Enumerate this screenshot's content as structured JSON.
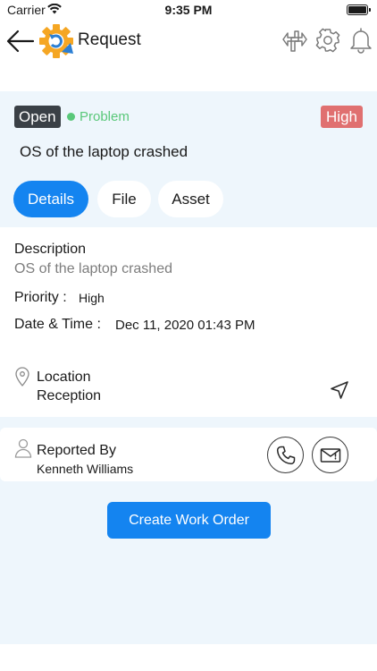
{
  "status_bar": {
    "carrier": "Carrier",
    "time": "9:35 PM",
    "battery_level": 1.0
  },
  "header": {
    "title": "Request"
  },
  "request": {
    "status": "Open",
    "type": "Problem",
    "priority_badge": "High",
    "subject": "OS of the laptop crashed"
  },
  "tabs": [
    {
      "label": "Details",
      "active": true
    },
    {
      "label": "File",
      "active": false
    },
    {
      "label": "Asset",
      "active": false
    }
  ],
  "details": {
    "description_label": "Description",
    "description_value": "OS of the laptop crashed",
    "priority_label": "Priority :",
    "priority_value": "High",
    "datetime_label": "Date & Time :",
    "datetime_value": "Dec 11, 2020 01:43 PM",
    "location_label": "Location",
    "location_value": "Reception"
  },
  "reporter": {
    "label": "Reported By",
    "name": "Kenneth Williams"
  },
  "actions": {
    "create_work_order": "Create Work Order"
  },
  "colors": {
    "accent": "#1484f0",
    "status_dark": "#3a4046",
    "priority_high": "#e07070",
    "problem_green": "#5ac87a",
    "section_bg": "#eef6fc",
    "logo_orange": "#f5a623",
    "logo_blue": "#2b7fd4"
  },
  "icons": {
    "back": "arrow-left-icon",
    "logo": "gear-refresh-logo",
    "switch": "switch-arrows-icon",
    "settings": "gear-icon",
    "notifications": "bell-icon",
    "location": "map-pin-icon",
    "navigate": "navigation-arrow-icon",
    "reporter": "person-icon",
    "phone": "phone-icon",
    "mail": "mail-icon"
  }
}
